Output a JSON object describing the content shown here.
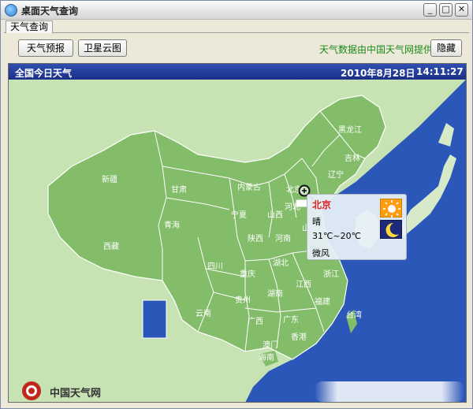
{
  "window": {
    "title": "桌面天气查询"
  },
  "tabs": [
    {
      "label": "天气查询"
    }
  ],
  "toolbar": {
    "forecast_label": "天气预报",
    "satellite_label": "卫星云图",
    "provider_text": "天气数据由中国天气网提供",
    "hide_label": "隐藏"
  },
  "map": {
    "title": "全国今日天气",
    "date": "2010年8月28日",
    "time": "14:11:27",
    "provinces": [
      "新疆",
      "西藏",
      "甘肃",
      "青海",
      "内蒙古",
      "宁夏",
      "陕西",
      "山西",
      "河北",
      "北京",
      "河南",
      "山东",
      "四川",
      "重庆",
      "湖北",
      "湖南",
      "贵州",
      "云南",
      "广西",
      "广东",
      "江西",
      "浙江",
      "福建",
      "黑龙江",
      "吉林",
      "辽宁"
    ],
    "cities": [
      "香港",
      "澳门",
      "台湾",
      "海南"
    ]
  },
  "popup": {
    "city": "北京",
    "weather": "晴",
    "temperature": "31℃~20℃",
    "wind": "微风",
    "day_icon": "sun-icon",
    "night_icon": "moon-icon"
  },
  "footer": {
    "brand": "中国天气网"
  },
  "colors": {
    "land": "#84bd6a",
    "sea": "#2a57b8",
    "header": "#1a2f86",
    "city_highlight": "#e02020",
    "provider": "#1a8a1a"
  }
}
